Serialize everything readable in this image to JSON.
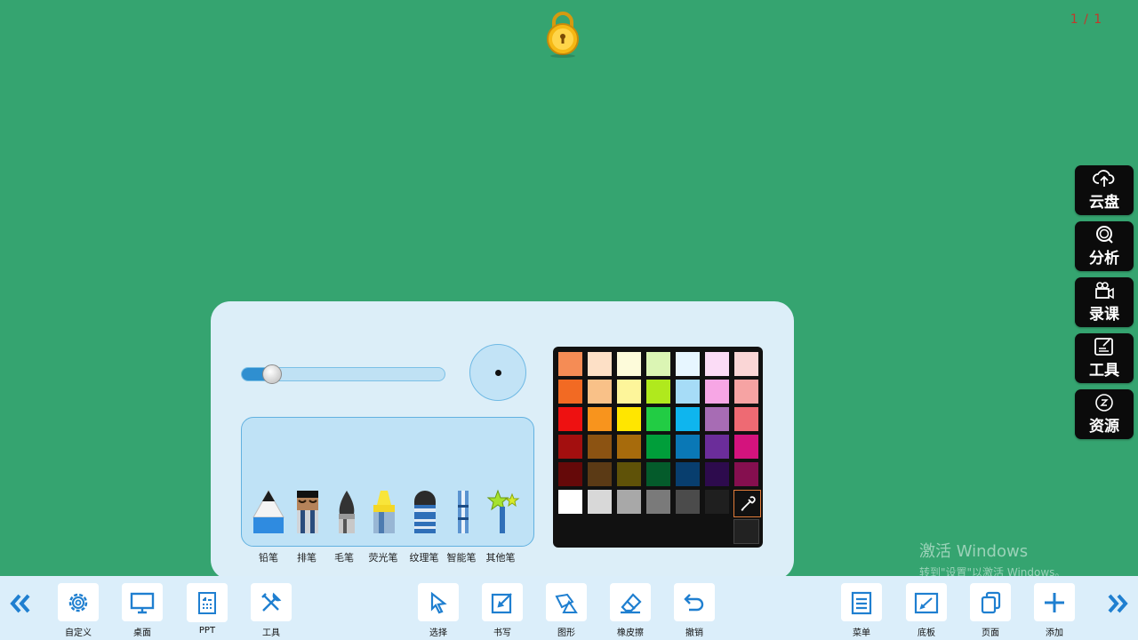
{
  "page_indicator": "1 / 1",
  "side_panel": [
    {
      "label": "云盘",
      "icon": "cloud-upload-icon"
    },
    {
      "label": "分析",
      "icon": "magnifier-icon"
    },
    {
      "label": "录课",
      "icon": "video-camera-icon"
    },
    {
      "label": "工具",
      "icon": "edit-box-icon"
    },
    {
      "label": "资源",
      "icon": "resource-z-icon"
    }
  ],
  "pen_panel": {
    "size_fraction": 0.1,
    "pens": [
      "铅笔",
      "排笔",
      "毛笔",
      "荧光笔",
      "纹理笔",
      "智能笔",
      "其他笔"
    ],
    "palette_rows": [
      [
        "#f58c55",
        "#fde0c6",
        "#fdfbda",
        "#dbf5b4",
        "#e7f6ff",
        "#fbdcf6",
        "#fad6d6"
      ],
      [
        "#f26a23",
        "#f9c188",
        "#fdf59a",
        "#b0e91d",
        "#a6dcf7",
        "#f7a6e5",
        "#f6a3a3"
      ],
      [
        "#ee1111",
        "#f8941d",
        "#ffe600",
        "#22cc44",
        "#0fb5ee",
        "#a76cb4",
        "#ee6a73"
      ],
      [
        "#a30f0f",
        "#8c5312",
        "#a76b0c",
        "#009e3a",
        "#0a78b6",
        "#6b2d9a",
        "#d4137d"
      ],
      [
        "#650909",
        "#5b3a15",
        "#5f5208",
        "#045b2b",
        "#083e6e",
        "#2d0b4d",
        "#850f4f"
      ],
      [
        "#ffffff",
        "#d8d8d8",
        "#a8a8a8",
        "#7a7a7a",
        "#4b4b4b",
        "#1f1f1f",
        null
      ]
    ]
  },
  "watermark": {
    "title": "激活 Windows",
    "subtitle": "转到\"设置\"以激活 Windows。"
  },
  "toolbar": {
    "left": [
      {
        "label": "自定义",
        "icon": "gear-icon"
      },
      {
        "label": "桌面",
        "icon": "monitor-icon"
      },
      {
        "label": "PPT",
        "icon": "ppt-icon"
      },
      {
        "label": "工具",
        "icon": "tools-icon"
      }
    ],
    "center": [
      {
        "label": "选择",
        "icon": "select-arrow-icon"
      },
      {
        "label": "书写",
        "icon": "write-icon"
      },
      {
        "label": "图形",
        "icon": "shapes-icon"
      },
      {
        "label": "橡皮擦",
        "icon": "eraser-icon"
      },
      {
        "label": "撤销",
        "icon": "undo-icon"
      }
    ],
    "right": [
      {
        "label": "菜单",
        "icon": "menu-icon"
      },
      {
        "label": "底板",
        "icon": "board-icon"
      },
      {
        "label": "页面",
        "icon": "pages-icon"
      },
      {
        "label": "添加",
        "icon": "plus-icon"
      }
    ]
  }
}
